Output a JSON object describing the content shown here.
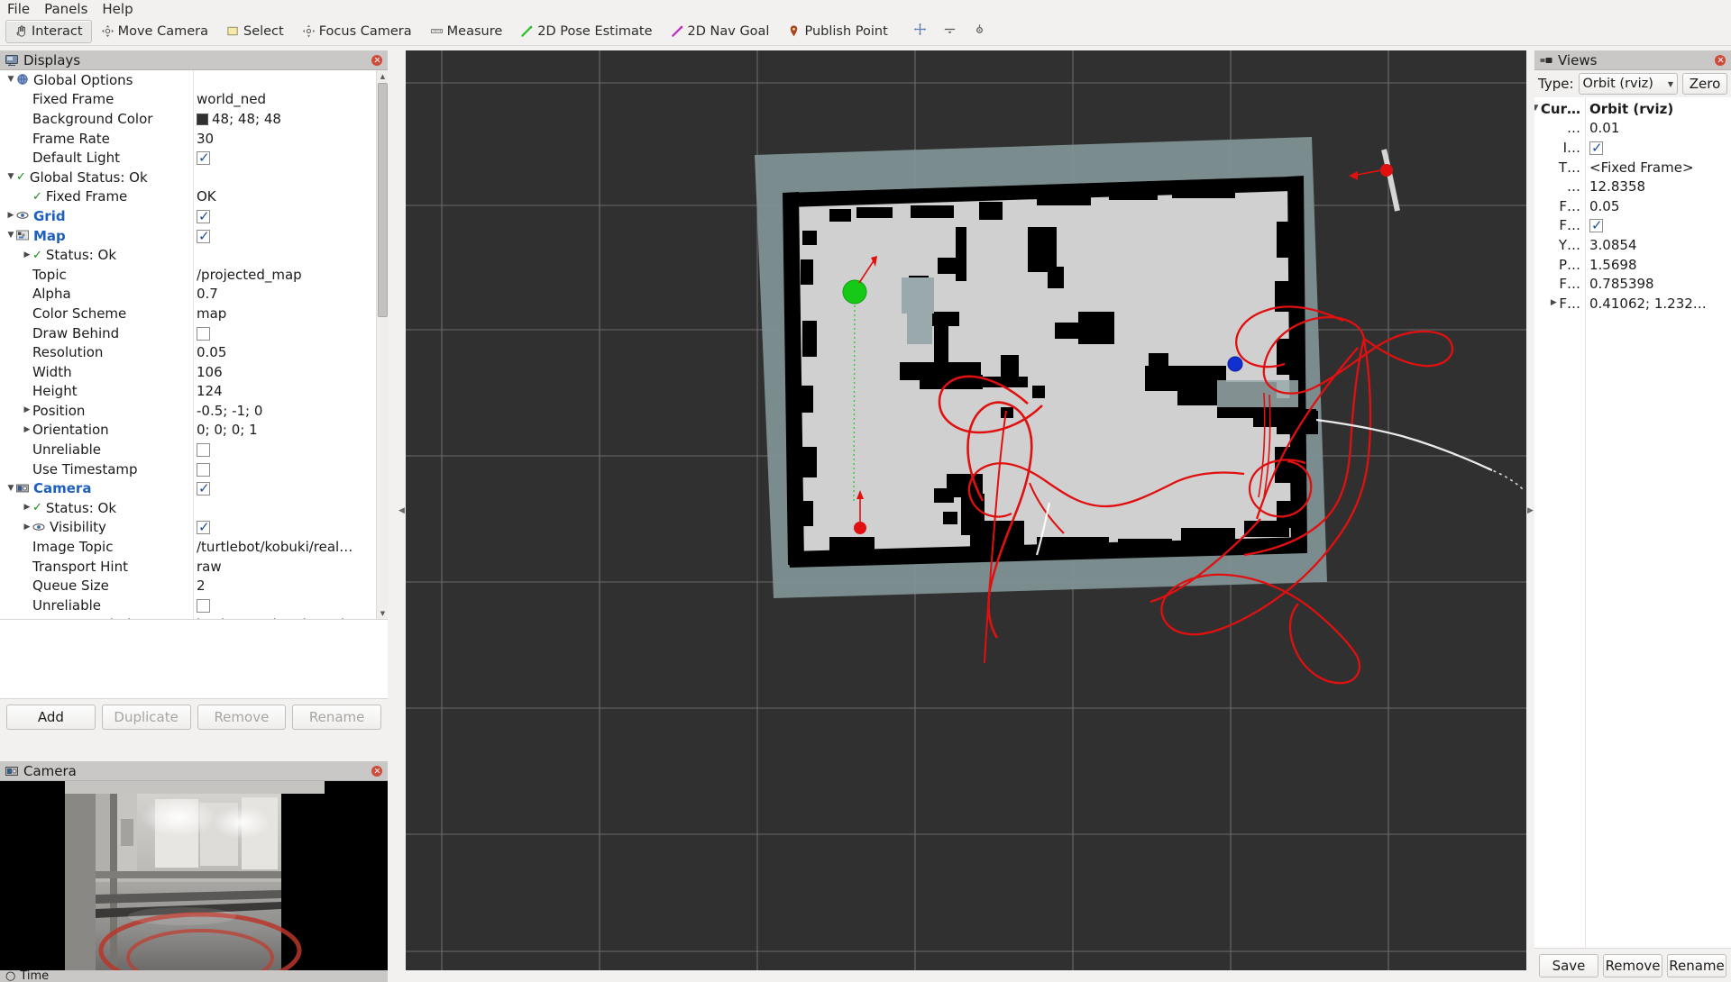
{
  "menubar": {
    "items": [
      "File",
      "Panels",
      "Help"
    ]
  },
  "toolbar": {
    "buttons": [
      {
        "label": "Interact",
        "icon": "hand-cursor-icon",
        "active": true
      },
      {
        "label": "Move Camera",
        "icon": "move-camera-icon",
        "active": false
      },
      {
        "label": "Select",
        "icon": "select-rect-icon",
        "active": false
      },
      {
        "label": "Focus Camera",
        "icon": "focus-camera-icon",
        "active": false
      },
      {
        "label": "Measure",
        "icon": "measure-icon",
        "active": false
      },
      {
        "label": "2D Pose Estimate",
        "icon": "pose-estimate-icon",
        "active": false
      },
      {
        "label": "2D Nav Goal",
        "icon": "nav-goal-icon",
        "active": false
      },
      {
        "label": "Publish Point",
        "icon": "map-pin-icon",
        "active": false
      }
    ],
    "extra_icons": [
      "plus-move-icon",
      "minus-arrow-icon",
      "target-icon"
    ]
  },
  "displays": {
    "title": "Displays",
    "title_icon": "display-panel-icon",
    "rows": [
      {
        "indent": 0,
        "arrow": "down",
        "icon": "globe-icon",
        "label": "Global Options",
        "style": "plain",
        "value": "",
        "vtype": "text"
      },
      {
        "indent": 1,
        "arrow": "none",
        "icon": "",
        "label": "Fixed Frame",
        "style": "plain",
        "value": "world_ned",
        "vtype": "text"
      },
      {
        "indent": 1,
        "arrow": "none",
        "icon": "",
        "label": "Background Color",
        "style": "plain",
        "value": "48; 48; 48",
        "vtype": "color",
        "color": "#303030"
      },
      {
        "indent": 1,
        "arrow": "none",
        "icon": "",
        "label": "Frame Rate",
        "style": "plain",
        "value": "30",
        "vtype": "text"
      },
      {
        "indent": 1,
        "arrow": "none",
        "icon": "",
        "label": "Default Light",
        "style": "plain",
        "value": "",
        "vtype": "check-on"
      },
      {
        "indent": 0,
        "arrow": "down",
        "icon": "ok-check",
        "label": "Global Status: Ok",
        "style": "plain",
        "value": "",
        "vtype": "text"
      },
      {
        "indent": 1,
        "arrow": "none",
        "icon": "ok-check",
        "label": "Fixed Frame",
        "style": "plain",
        "value": "OK",
        "vtype": "text"
      },
      {
        "indent": 0,
        "arrow": "right",
        "icon": "eye-icon",
        "label": "Grid",
        "style": "blue",
        "value": "",
        "vtype": "check-on"
      },
      {
        "indent": 0,
        "arrow": "down",
        "icon": "map-icon",
        "label": "Map",
        "style": "blue",
        "value": "",
        "vtype": "check-on"
      },
      {
        "indent": 1,
        "arrow": "right",
        "icon": "ok-check",
        "label": "Status: Ok",
        "style": "plain",
        "value": "",
        "vtype": "text"
      },
      {
        "indent": 1,
        "arrow": "none",
        "icon": "",
        "label": "Topic",
        "style": "plain",
        "value": "/projected_map",
        "vtype": "text"
      },
      {
        "indent": 1,
        "arrow": "none",
        "icon": "",
        "label": "Alpha",
        "style": "plain",
        "value": "0.7",
        "vtype": "text"
      },
      {
        "indent": 1,
        "arrow": "none",
        "icon": "",
        "label": "Color Scheme",
        "style": "plain",
        "value": "map",
        "vtype": "text"
      },
      {
        "indent": 1,
        "arrow": "none",
        "icon": "",
        "label": "Draw Behind",
        "style": "plain",
        "value": "",
        "vtype": "check-off"
      },
      {
        "indent": 1,
        "arrow": "none",
        "icon": "",
        "label": "Resolution",
        "style": "plain",
        "value": "0.05",
        "vtype": "text"
      },
      {
        "indent": 1,
        "arrow": "none",
        "icon": "",
        "label": "Width",
        "style": "plain",
        "value": "106",
        "vtype": "text"
      },
      {
        "indent": 1,
        "arrow": "none",
        "icon": "",
        "label": "Height",
        "style": "plain",
        "value": "124",
        "vtype": "text"
      },
      {
        "indent": 1,
        "arrow": "right",
        "icon": "",
        "label": "Position",
        "style": "plain",
        "value": "-0.5; -1; 0",
        "vtype": "text"
      },
      {
        "indent": 1,
        "arrow": "right",
        "icon": "",
        "label": "Orientation",
        "style": "plain",
        "value": "0; 0; 0; 1",
        "vtype": "text"
      },
      {
        "indent": 1,
        "arrow": "none",
        "icon": "",
        "label": "Unreliable",
        "style": "plain",
        "value": "",
        "vtype": "check-off"
      },
      {
        "indent": 1,
        "arrow": "none",
        "icon": "",
        "label": "Use Timestamp",
        "style": "plain",
        "value": "",
        "vtype": "check-off"
      },
      {
        "indent": 0,
        "arrow": "down",
        "icon": "camera-icon",
        "label": "Camera",
        "style": "blue",
        "value": "",
        "vtype": "check-on"
      },
      {
        "indent": 1,
        "arrow": "right",
        "icon": "ok-check",
        "label": "Status: Ok",
        "style": "plain",
        "value": "",
        "vtype": "text"
      },
      {
        "indent": 1,
        "arrow": "right",
        "icon": "eye-icon",
        "label": "Visibility",
        "style": "plain",
        "value": "",
        "vtype": "check-on"
      },
      {
        "indent": 1,
        "arrow": "none",
        "icon": "",
        "label": "Image Topic",
        "style": "plain",
        "value": "/turtlebot/kobuki/real…",
        "vtype": "text"
      },
      {
        "indent": 1,
        "arrow": "none",
        "icon": "",
        "label": "Transport Hint",
        "style": "plain",
        "value": "raw",
        "vtype": "text"
      },
      {
        "indent": 1,
        "arrow": "none",
        "icon": "",
        "label": "Queue Size",
        "style": "plain",
        "value": "2",
        "vtype": "text"
      },
      {
        "indent": 1,
        "arrow": "none",
        "icon": "",
        "label": "Unreliable",
        "style": "plain",
        "value": "",
        "vtype": "check-off"
      },
      {
        "indent": 1,
        "arrow": "none",
        "icon": "",
        "label": "Image Rendering",
        "style": "plain",
        "value": "background and overlay",
        "vtype": "text"
      }
    ],
    "buttons": [
      {
        "label": "Add",
        "enabled": true
      },
      {
        "label": "Duplicate",
        "enabled": false
      },
      {
        "label": "Remove",
        "enabled": false
      },
      {
        "label": "Rename",
        "enabled": false
      }
    ]
  },
  "camera_panel": {
    "title": "Camera",
    "title_icon": "camera-panel-icon"
  },
  "time_panel": {
    "title": "Time",
    "title_icon": "clock-icon"
  },
  "views": {
    "title": "Views",
    "title_icon": "views-panel-icon",
    "type_label": "Type:",
    "type_value": "Orbit (rviz)",
    "zero_label": "Zero",
    "rows": [
      {
        "arrow": "down",
        "key": "Cur…",
        "value": "Orbit (rviz)",
        "bold": true,
        "vtype": "text"
      },
      {
        "arrow": "none",
        "key": "…",
        "value": "0.01",
        "bold": false,
        "vtype": "text"
      },
      {
        "arrow": "none",
        "key": "I…",
        "value": "",
        "bold": false,
        "vtype": "check-on"
      },
      {
        "arrow": "none",
        "key": "T…",
        "value": "<Fixed Frame>",
        "bold": false,
        "vtype": "text"
      },
      {
        "arrow": "none",
        "key": "…",
        "value": "12.8358",
        "bold": false,
        "vtype": "text"
      },
      {
        "arrow": "none",
        "key": "F…",
        "value": "0.05",
        "bold": false,
        "vtype": "text"
      },
      {
        "arrow": "none",
        "key": "F…",
        "value": "",
        "bold": false,
        "vtype": "check-on"
      },
      {
        "arrow": "none",
        "key": "Y…",
        "value": "3.0854",
        "bold": false,
        "vtype": "text"
      },
      {
        "arrow": "none",
        "key": "P…",
        "value": "1.5698",
        "bold": false,
        "vtype": "text"
      },
      {
        "arrow": "none",
        "key": "F…",
        "value": "0.785398",
        "bold": false,
        "vtype": "text"
      },
      {
        "arrow": "right",
        "key": "F…",
        "value": "0.41062; 1.232…",
        "bold": false,
        "vtype": "text"
      }
    ],
    "buttons": [
      "Save",
      "Remove",
      "Rename"
    ]
  },
  "colors": {
    "background_3d": "#303030",
    "grid_line": "#9a9a9a",
    "map_free": "#d0d0d0",
    "map_occupied": "#000000",
    "map_unknown": "#7f9194",
    "path_trail": "#e01010",
    "goal_marker": "#16c916",
    "robot_marker": "#1030d0",
    "panel_header": "#c9c8c6",
    "panel_bg": "#f2f1f0",
    "link_blue": "#1f5fbf",
    "status_green": "#1d8a1d"
  }
}
